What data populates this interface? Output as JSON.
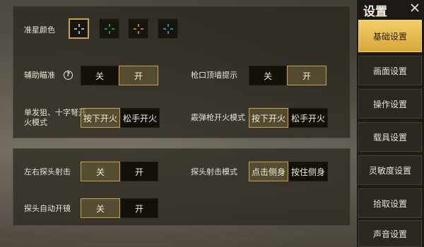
{
  "sidebar": {
    "title": "设置",
    "items": [
      {
        "label": "基础设置",
        "active": true
      },
      {
        "label": "画面设置",
        "active": false
      },
      {
        "label": "操作设置",
        "active": false
      },
      {
        "label": "载具设置",
        "active": false
      },
      {
        "label": "灵敏度设置",
        "active": false
      },
      {
        "label": "拾取设置",
        "active": false
      },
      {
        "label": "声音设置",
        "active": false
      }
    ]
  },
  "crosshair": {
    "label": "准星颜色",
    "colors": [
      {
        "name": "white",
        "hex": "#ffffff",
        "selected": true
      },
      {
        "name": "green",
        "hex": "#34d34a",
        "selected": false
      },
      {
        "name": "yellow",
        "hex": "#e8c22c",
        "selected": false
      },
      {
        "name": "cyan",
        "hex": "#3fc7e6",
        "selected": false
      }
    ]
  },
  "settings": {
    "aim_assist": {
      "label": "辅助瞄准",
      "help": "?",
      "options": [
        "关",
        "开"
      ],
      "selected": 1
    },
    "muzzle_tip": {
      "label": "枪口顶墙提示",
      "options": [
        "关",
        "开"
      ],
      "selected": 1
    },
    "single_fire": {
      "label": "单发狙、十字弩开火模式",
      "options": [
        "按下开火",
        "松手开火"
      ],
      "selected": 0
    },
    "shotgun_fire": {
      "label": "霰弹枪开火模式",
      "options": [
        "按下开火",
        "松手开火"
      ],
      "selected": 0
    },
    "lean_fire": {
      "label": "左右探头射击",
      "options": [
        "关",
        "开"
      ],
      "selected": 0
    },
    "lean_mode": {
      "label": "探头射击模式",
      "options": [
        "点击侧身",
        "按住侧身"
      ],
      "selected": 0
    },
    "auto_scope": {
      "label": "探头自动开镜",
      "options": [
        "关",
        "开"
      ],
      "selected": 0
    }
  },
  "colors": {
    "accent": "#c9a24c",
    "active_tab": "#e8b94a"
  }
}
